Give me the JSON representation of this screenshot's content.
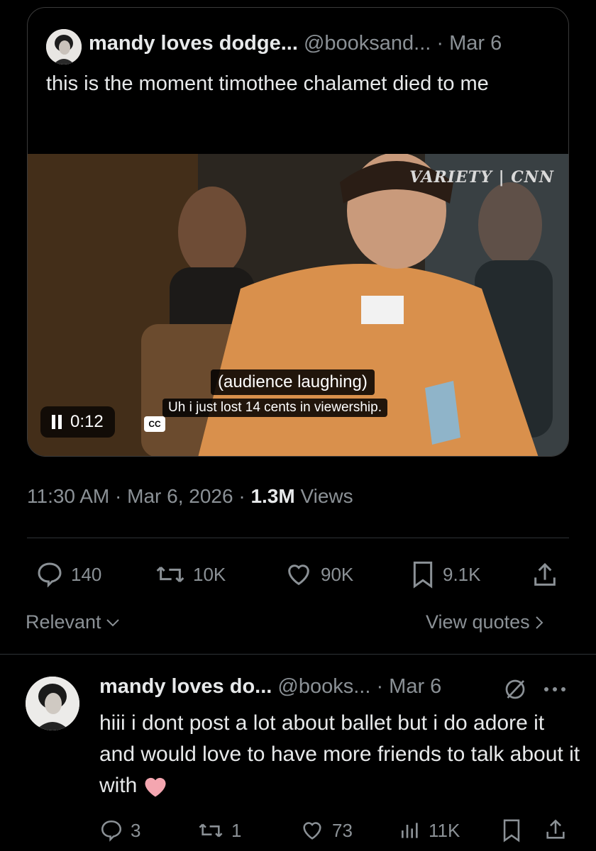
{
  "quoted_tweet": {
    "display_name": "mandy loves dodge...",
    "handle": "@booksand...",
    "date": "· Mar 6",
    "text": "this is the moment timothee chalamet died to me",
    "video": {
      "watermark": "VARIETY | CNN",
      "caption_1": "(audience laughing)",
      "caption_2": "Uh i just lost 14 cents in viewership.",
      "time": "0:12",
      "cc_label": "CC"
    }
  },
  "tweet_meta": {
    "time": "11:30 AM",
    "date": "Mar 6, 2026",
    "views_count": "1.3M",
    "views_label": "Views"
  },
  "actions": {
    "replies": "140",
    "reposts": "10K",
    "likes": "90K",
    "bookmarks": "9.1K"
  },
  "reply_filter": {
    "sort_label": "Relevant",
    "view_quotes": "View quotes"
  },
  "reply": {
    "display_name": "mandy loves do...",
    "handle": "@books...",
    "date": "· Mar 6",
    "text": "hiii i dont post a lot about ballet but i do adore it and would love to have more friends to talk about it with",
    "replies": "3",
    "reposts": "1",
    "likes": "73",
    "views": "11K"
  },
  "colors": {
    "background": "#000000",
    "text": "#e7e9ea",
    "muted": "#8b9196",
    "divider": "#2f3336",
    "heart": "#f4a6b0"
  }
}
